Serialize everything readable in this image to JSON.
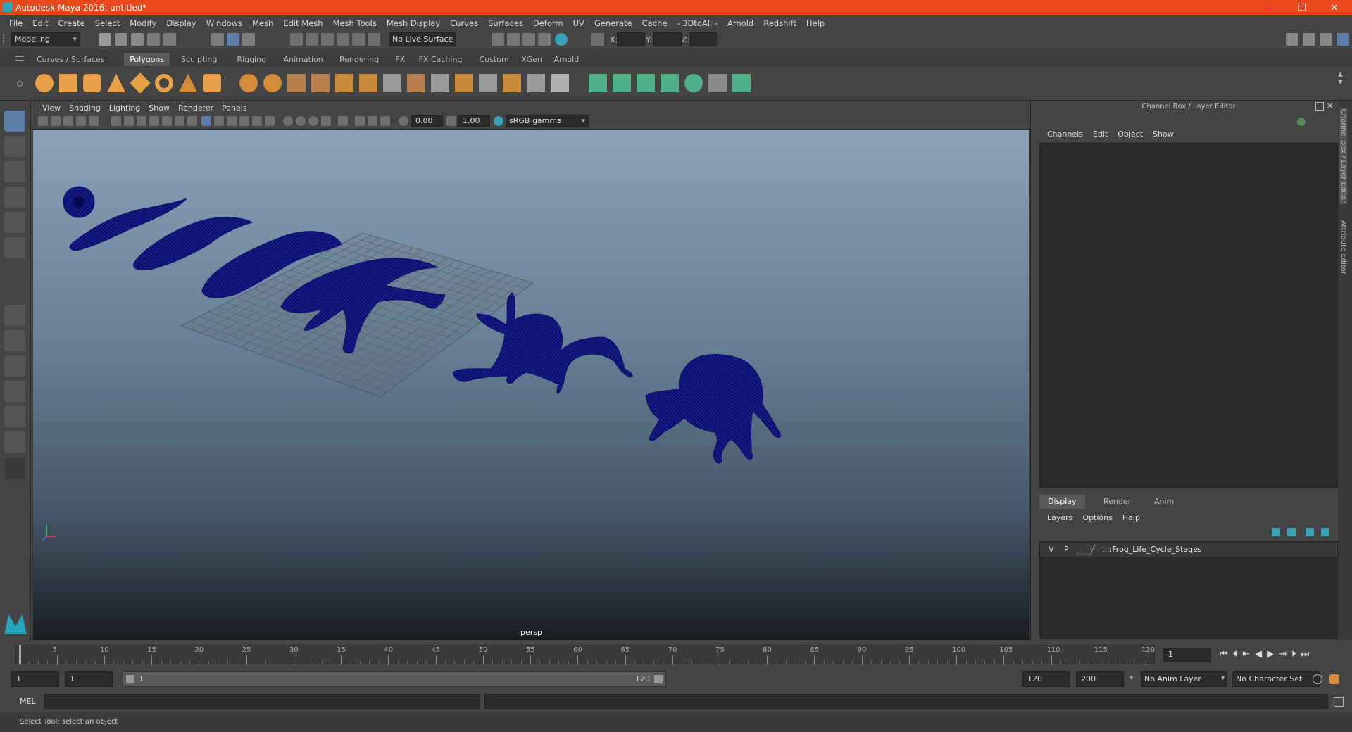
{
  "window": {
    "title": "Autodesk Maya 2016: untitled*",
    "min": "—",
    "restore": "❐",
    "close": "✕"
  },
  "menubar": [
    "File",
    "Edit",
    "Create",
    "Select",
    "Modify",
    "Display",
    "Windows",
    "Mesh",
    "Edit Mesh",
    "Mesh Tools",
    "Mesh Display",
    "Curves",
    "Surfaces",
    "Deform",
    "UV",
    "Generate",
    "Cache",
    "- 3DtoAll -",
    "Arnold",
    "Redshift",
    "Help"
  ],
  "status": {
    "mode": "Modeling",
    "live_surface": "No Live Surface",
    "x_label": "X:",
    "y_label": "Y:",
    "z_label": "Z:"
  },
  "shelf_tabs": [
    {
      "label": "Curves / Surfaces",
      "active": false
    },
    {
      "label": "Polygons",
      "active": true
    },
    {
      "label": "Sculpting",
      "active": false
    },
    {
      "label": "Rigging",
      "active": false
    },
    {
      "label": "Animation",
      "active": false
    },
    {
      "label": "Rendering",
      "active": false
    },
    {
      "label": "FX",
      "active": false
    },
    {
      "label": "FX Caching",
      "active": false
    },
    {
      "label": "Custom",
      "active": false
    },
    {
      "label": "XGen",
      "active": false
    },
    {
      "label": "Arnold",
      "active": false
    }
  ],
  "viewport": {
    "menus": [
      "View",
      "Shading",
      "Lighting",
      "Show",
      "Renderer",
      "Panels"
    ],
    "exposure": "0.00",
    "gamma": "1.00",
    "colorspace": "sRGB gamma",
    "camera": "persp",
    "mesh_color": "#0a0f6e"
  },
  "channel_box": {
    "title": "Channel Box / Layer Editor",
    "menus": [
      "Channels",
      "Edit",
      "Object",
      "Show"
    ]
  },
  "layer_editor": {
    "tabs": [
      {
        "label": "Display",
        "active": true
      },
      {
        "label": "Render",
        "active": false
      },
      {
        "label": "Anim",
        "active": false
      }
    ],
    "menus": [
      "Layers",
      "Options",
      "Help"
    ],
    "layer": {
      "v": "V",
      "p": "P",
      "name": "...:Frog_Life_Cycle_Stages"
    }
  },
  "side_tabs": {
    "channel": "Channel Box / Layer Editor",
    "attribute": "Attribute Editor"
  },
  "timeline": {
    "ticks": [
      1,
      5,
      10,
      15,
      20,
      25,
      30,
      35,
      40,
      45,
      50,
      55,
      60,
      65,
      70,
      75,
      80,
      85,
      90,
      95,
      100,
      105,
      110,
      115,
      120
    ],
    "current_frame": "1"
  },
  "range": {
    "start": "1",
    "inner_start": "1",
    "slider_start": "1",
    "slider_end": "120",
    "end": "120",
    "max": "200",
    "anim_layer": "No Anim Layer",
    "char_set": "No Character Set"
  },
  "command": {
    "label": "MEL"
  },
  "help": "Select Tool: select an object"
}
